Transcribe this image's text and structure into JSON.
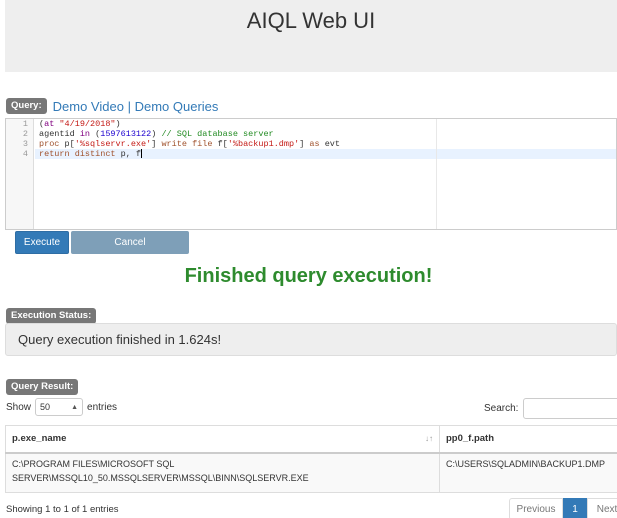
{
  "header": {
    "title": "AIQL Web UI"
  },
  "query_section": {
    "badge": "Query:",
    "link_demo_video": "Demo Video",
    "separator": "|",
    "link_demo_queries": "Demo Queries"
  },
  "editor": {
    "line_numbers": [
      "1",
      "2",
      "3",
      "4"
    ],
    "lines": [
      "(at \"4/19/2018\")",
      "agentid in (1597613122) // SQL database server",
      "proc p['%sqlservr.exe'] write file f['%backup1.dmp'] as evt",
      "return distinct p, f"
    ]
  },
  "buttons": {
    "execute": "Execute",
    "cancel": "Cancel"
  },
  "result_message": "Finished query execution!",
  "execution_status": {
    "badge": "Execution Status:",
    "text": "Query execution finished in 1.624s!"
  },
  "query_result": {
    "badge": "Query Result:",
    "show_prefix": "Show",
    "page_size": "50",
    "show_suffix": "entries",
    "search_label": "Search:",
    "columns": [
      "p.exe_name",
      "pp0_f.path"
    ],
    "rows": [
      [
        "C:\\PROGRAM FILES\\MICROSOFT SQL SERVER\\MSSQL10_50.MSSQLSERVER\\MSSQL\\BINN\\SQLSERVR.EXE",
        "C:\\USERS\\SQLADMIN\\BACKUP1.DMP"
      ]
    ],
    "info": "Showing 1 to 1 of 1 entries",
    "pagination": {
      "previous": "Previous",
      "current": "1",
      "next": "Next"
    }
  },
  "colors": {
    "accent": "#337ab7",
    "success": "#2e8b2e",
    "badge": "#777777",
    "cancel": "#7e9fb8"
  }
}
